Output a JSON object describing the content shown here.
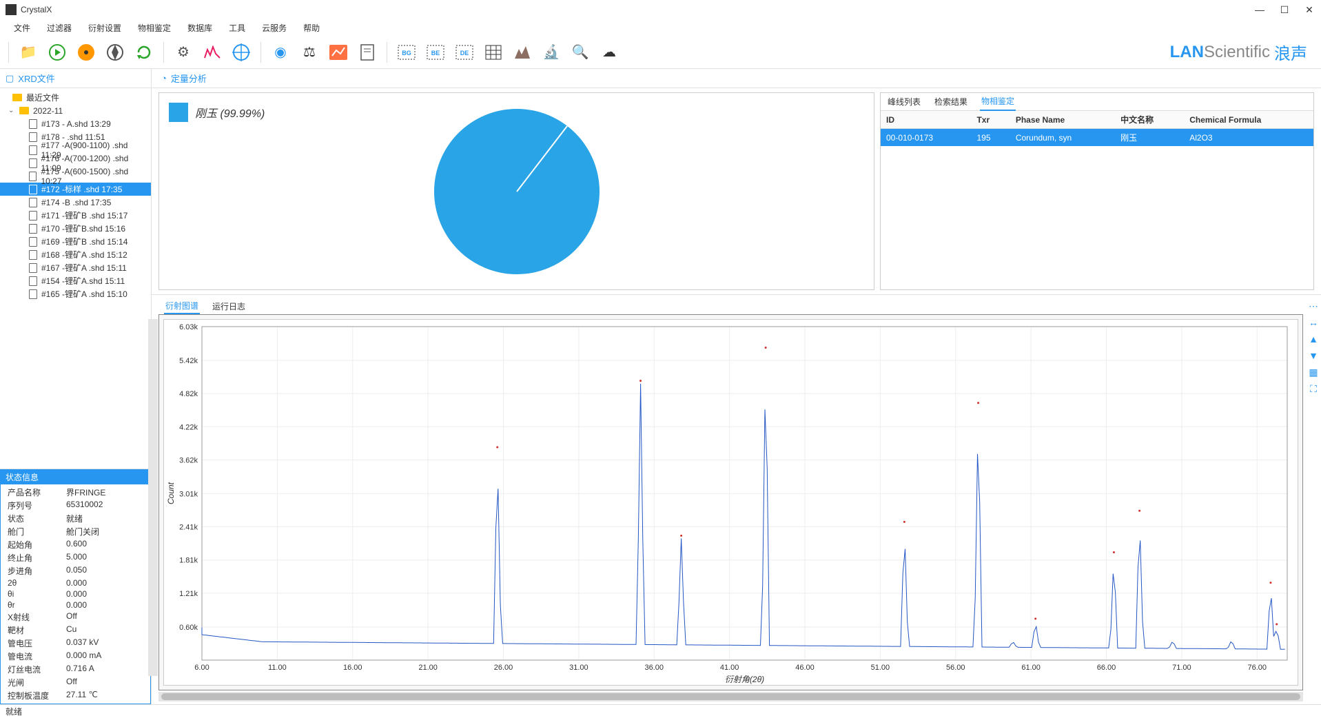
{
  "app": {
    "title": "CrystalX"
  },
  "window_buttons": {
    "min": "—",
    "max": "☐",
    "close": "✕"
  },
  "menubar": [
    "文件",
    "过滤器",
    "衍射设置",
    "物相鉴定",
    "数据库",
    "工具",
    "云服务",
    "帮助"
  ],
  "brand": {
    "part1": "LAN",
    "part2": "Scientific",
    "cn": "浪声"
  },
  "left_panel": {
    "title": "XRD文件",
    "recent": "最近文件",
    "folder": "2022-11",
    "files": [
      "#173 - A.shd 13:29",
      "#178 - .shd 11:51",
      "#177 -A(900-1100) .shd 11:29",
      "#176 -A(700-1200) .shd 11:09",
      "#175 -A(600-1500) .shd 10:27",
      "#172 -标样 .shd 17:35",
      "#174 -B .shd 17:35",
      "#171 -锂矿B .shd 15:17",
      "#170 -锂矿B.shd 15:16",
      "#169 -锂矿B .shd 15:14",
      "#168 -锂矿A .shd 15:12",
      "#167 -锂矿A .shd 15:11",
      "#154 -锂矿A.shd 15:11",
      "#165 -锂矿A .shd 15:10"
    ],
    "selected_index": 5
  },
  "status_panel": {
    "title": "状态信息",
    "rows": [
      {
        "k": "产品名称",
        "v": "界FRINGE"
      },
      {
        "k": "序列号",
        "v": "65310002"
      },
      {
        "k": "状态",
        "v": "就绪"
      },
      {
        "k": "舱门",
        "v": "舱门关闭"
      },
      {
        "k": "起始角",
        "v": "0.600"
      },
      {
        "k": "终止角",
        "v": "5.000"
      },
      {
        "k": "步进角",
        "v": "0.050"
      },
      {
        "k": "2θ",
        "v": "0.000"
      },
      {
        "k": "θi",
        "v": "0.000"
      },
      {
        "k": "θr",
        "v": "0.000"
      },
      {
        "k": "X射线",
        "v": "Off"
      },
      {
        "k": "靶材",
        "v": "Cu"
      },
      {
        "k": "管电压",
        "v": "0.037 kV"
      },
      {
        "k": "管电流",
        "v": "0.000 mA"
      },
      {
        "k": "灯丝电流",
        "v": "0.716 A"
      },
      {
        "k": "光闸",
        "v": "Off"
      },
      {
        "k": "控制板温度",
        "v": "27.11 ℃"
      }
    ]
  },
  "analysis": {
    "title": "定量分析"
  },
  "pie": {
    "label": "刚玉 (99.99%)"
  },
  "table": {
    "tabs": [
      "峰线列表",
      "检索结果",
      "物相鉴定"
    ],
    "active_tab": 2,
    "headers": [
      "ID",
      "Txr",
      "Phase Name",
      "中文名称",
      "Chemical Formula"
    ],
    "rows": [
      {
        "id": "00-010-0173",
        "txr": "195",
        "phase": "Corundum, syn",
        "cn": "刚玉",
        "formula": "Al2O3"
      }
    ]
  },
  "chart_panel": {
    "tabs": [
      "衍射图谱",
      "运行日志"
    ],
    "active_tab": 0
  },
  "statusbar": {
    "text": "就绪"
  },
  "chart_data": {
    "type": "line",
    "title": "",
    "xlabel": "衍射角(2θ)",
    "ylabel": "Count",
    "xlim": [
      6,
      78
    ],
    "ylim": [
      0,
      6030
    ],
    "xticks": [
      6,
      11,
      16,
      21,
      26,
      31,
      36,
      41,
      46,
      51,
      56,
      61,
      66,
      71,
      76
    ],
    "yticks_labels": [
      "0.60k",
      "1.21k",
      "1.81k",
      "2.41k",
      "3.01k",
      "3.62k",
      "4.22k",
      "4.82k",
      "5.42k",
      "6.03k"
    ],
    "yticks": [
      600,
      1210,
      1810,
      2410,
      3010,
      3620,
      4220,
      4820,
      5420,
      6030
    ],
    "baseline": 300,
    "peaks": [
      {
        "x": 25.6,
        "y": 3800
      },
      {
        "x": 35.1,
        "y": 5000
      },
      {
        "x": 37.8,
        "y": 2200
      },
      {
        "x": 43.4,
        "y": 5600
      },
      {
        "x": 52.6,
        "y": 2450
      },
      {
        "x": 57.5,
        "y": 4600
      },
      {
        "x": 59.8,
        "y": 340
      },
      {
        "x": 61.3,
        "y": 700
      },
      {
        "x": 66.5,
        "y": 1900
      },
      {
        "x": 68.2,
        "y": 2650
      },
      {
        "x": 70.4,
        "y": 350
      },
      {
        "x": 74.3,
        "y": 360
      },
      {
        "x": 76.9,
        "y": 1350
      },
      {
        "x": 77.3,
        "y": 600
      }
    ]
  }
}
